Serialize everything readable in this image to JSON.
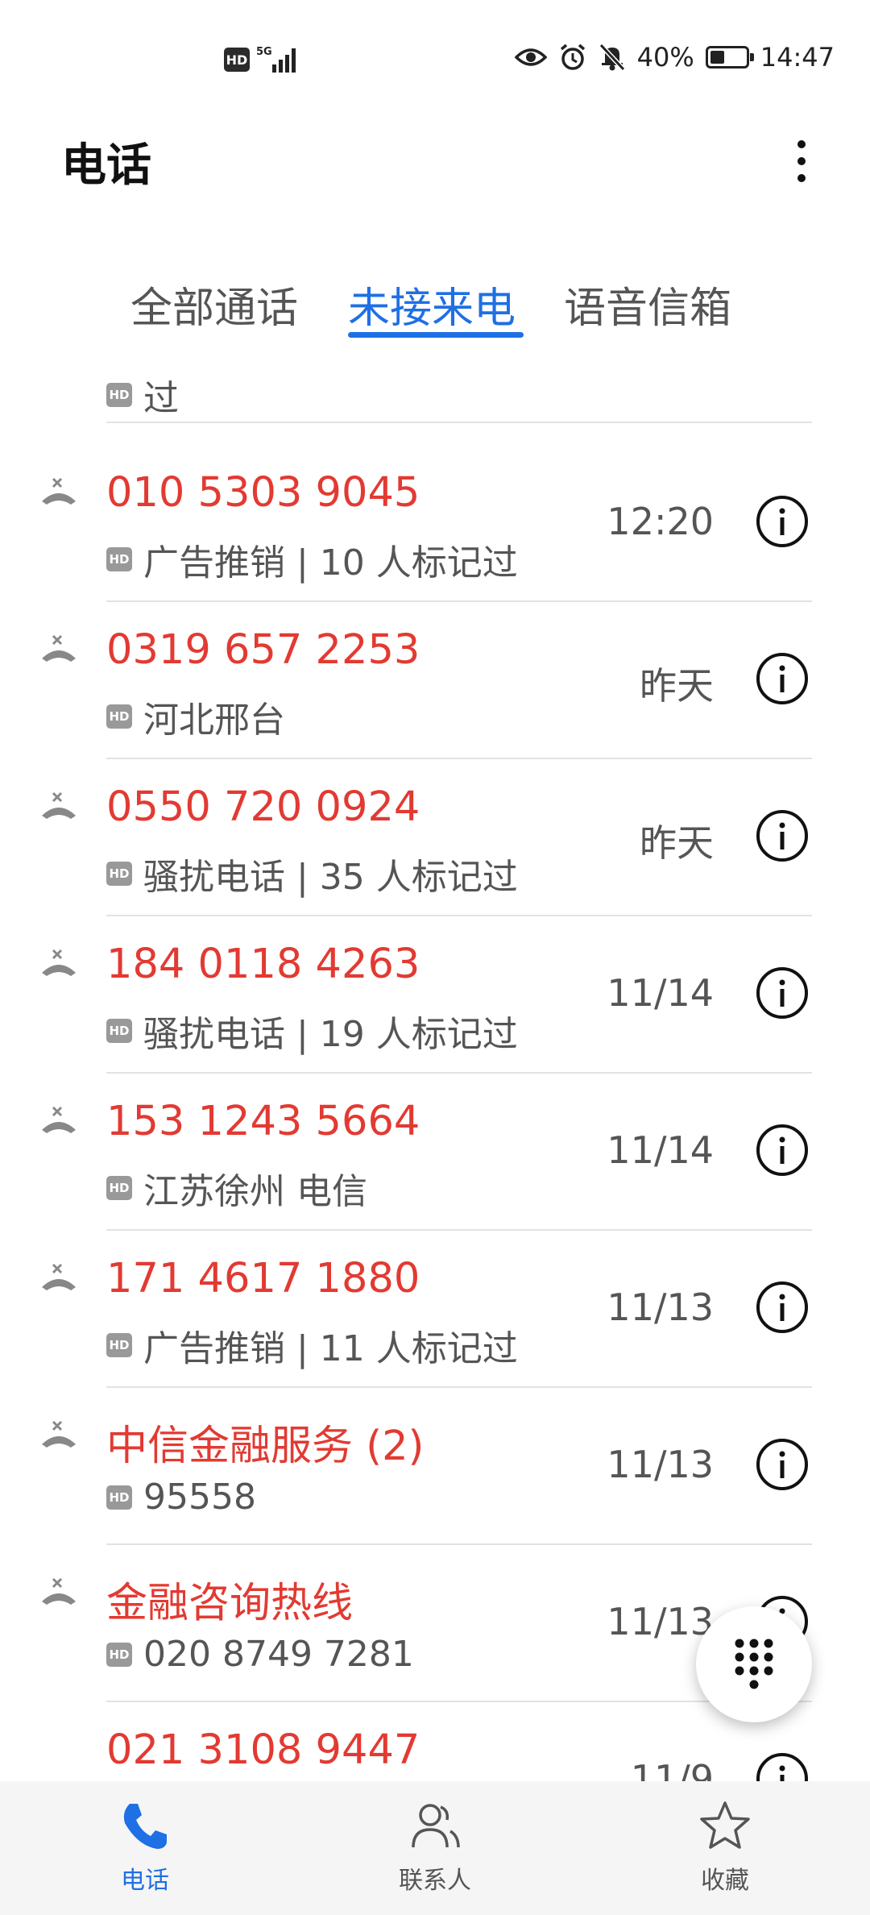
{
  "status_bar": {
    "hd": "HD",
    "network": "5G",
    "battery": "40%",
    "battery_level": 0.4,
    "time": "14:47"
  },
  "header": {
    "title": "电话"
  },
  "tabs": [
    {
      "label": "全部通话",
      "active": false
    },
    {
      "label": "未接来电",
      "active": true
    },
    {
      "label": "语音信箱",
      "active": false
    }
  ],
  "hd_badge": "HD",
  "calls": [
    {
      "name": "",
      "subtitle": "过",
      "time": ""
    },
    {
      "name": "010 5303 9045",
      "subtitle": "广告推销 | 10 人标记过",
      "time": "12:20"
    },
    {
      "name": "0319 657 2253",
      "subtitle": "河北邢台",
      "time": "昨天"
    },
    {
      "name": "0550 720 0924",
      "subtitle": "骚扰电话 | 35 人标记过",
      "time": "昨天"
    },
    {
      "name": "184 0118 4263",
      "subtitle": "骚扰电话 | 19 人标记过",
      "time": "11/14"
    },
    {
      "name": "153 1243 5664",
      "subtitle": "江苏徐州 电信",
      "time": "11/14"
    },
    {
      "name": "171 4617 1880",
      "subtitle": "广告推销 | 11 人标记过",
      "time": "11/13"
    },
    {
      "name": "中信金融服务 (2)",
      "subtitle": "95558",
      "time": "11/13"
    },
    {
      "name": "金融咨询热线",
      "subtitle": "020 8749 7281",
      "time": "11/13"
    },
    {
      "name": "021 3108 9447",
      "subtitle": "",
      "time": "11/9"
    }
  ],
  "bottom_nav": [
    {
      "label": "电话",
      "icon": "phone-icon",
      "active": true
    },
    {
      "label": "联系人",
      "icon": "contacts-icon",
      "active": false
    },
    {
      "label": "收藏",
      "icon": "star-icon",
      "active": false
    }
  ],
  "colors": {
    "accent": "#1f6fe5",
    "missed": "#e23a32"
  }
}
